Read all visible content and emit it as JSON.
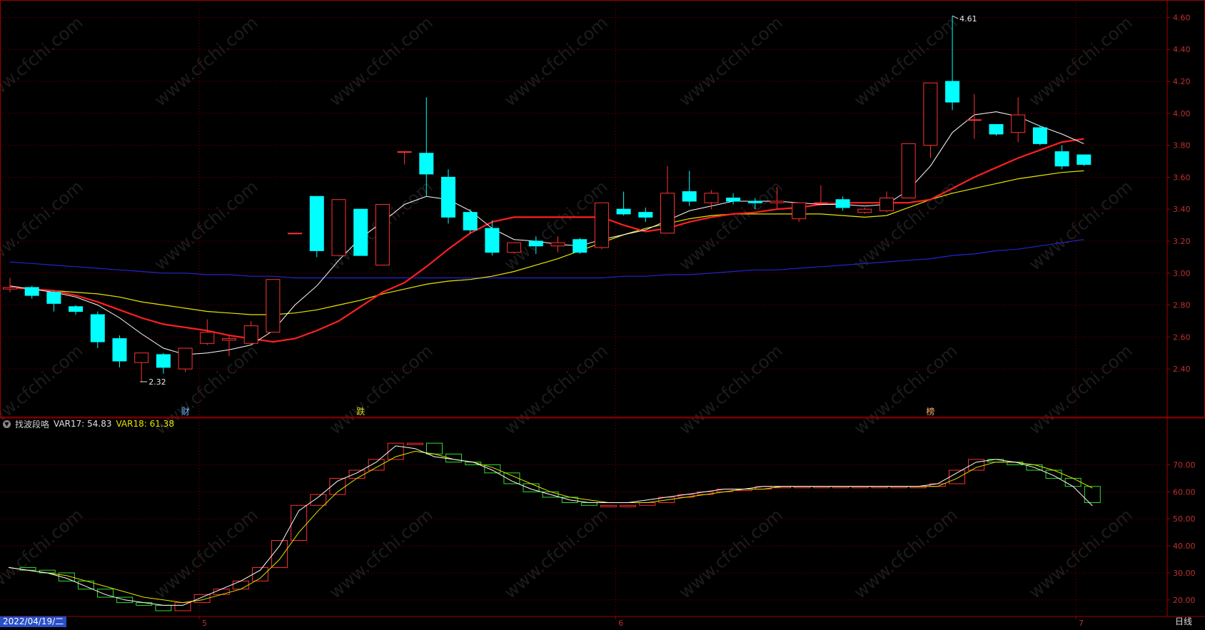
{
  "theme": {
    "background": "#000000",
    "border": "#a00000",
    "grid": "#7a0000",
    "axis_text": "#c03030",
    "up": "#ff3232",
    "down": "#00ffff",
    "ma5": "#ffffff",
    "ma10": "#ff2020",
    "ma20": "#e6e600",
    "ma60": "#2424d0",
    "osc_up": "#ff3030",
    "osc_down": "#33dd33",
    "osc_line_a": "#ffffff",
    "osc_line_b": "#e6e600"
  },
  "watermark": "www.cfchi.com",
  "price_panel": {
    "y_ticks": [
      "2.40",
      "2.60",
      "2.80",
      "3.00",
      "3.20",
      "3.40",
      "3.60",
      "3.80",
      "4.00",
      "4.20",
      "4.40",
      "4.60"
    ],
    "high_label": "4.61",
    "low_label": "2.32",
    "markers": [
      {
        "label": "财",
        "color": "#6fb4ff",
        "index": 8
      },
      {
        "label": "跌",
        "color": "#dddd22",
        "index": 16
      },
      {
        "label": "榜",
        "color": "#ffb070",
        "index": 42
      }
    ]
  },
  "indicator_panel": {
    "name": "找波段咯",
    "var17_label": "VAR17: 54.83",
    "var18_label": "VAR18: 61.38",
    "y_ticks": [
      "20.00",
      "30.00",
      "40.00",
      "50.00",
      "60.00",
      "70.00"
    ]
  },
  "x_axis": {
    "date_label": "2022/04/19/二",
    "month_labels": [
      {
        "label": "5",
        "index": 9
      },
      {
        "label": "6",
        "index": 28
      },
      {
        "label": "7",
        "index": 49
      }
    ],
    "period": "日线"
  },
  "chart_data": [
    {
      "type": "candlestick",
      "ylim": [
        2.28,
        4.66
      ],
      "y_ticks": [
        2.4,
        2.6,
        2.8,
        3.0,
        3.2,
        3.4,
        3.6,
        3.8,
        4.0,
        4.2,
        4.4,
        4.6
      ],
      "candles": [
        {
          "o": 2.9,
          "h": 2.97,
          "l": 2.88,
          "c": 2.91
        },
        {
          "o": 2.91,
          "h": 2.92,
          "l": 2.84,
          "c": 2.86
        },
        {
          "o": 2.88,
          "h": 2.89,
          "l": 2.76,
          "c": 2.81
        },
        {
          "o": 2.79,
          "h": 2.8,
          "l": 2.74,
          "c": 2.76
        },
        {
          "o": 2.74,
          "h": 2.76,
          "l": 2.53,
          "c": 2.57
        },
        {
          "o": 2.59,
          "h": 2.61,
          "l": 2.41,
          "c": 2.45
        },
        {
          "o": 2.44,
          "h": 2.5,
          "l": 2.32,
          "c": 2.5
        },
        {
          "o": 2.49,
          "h": 2.5,
          "l": 2.37,
          "c": 2.41
        },
        {
          "o": 2.4,
          "h": 2.53,
          "l": 2.38,
          "c": 2.53
        },
        {
          "o": 2.56,
          "h": 2.71,
          "l": 2.55,
          "c": 2.63
        },
        {
          "o": 2.58,
          "h": 2.61,
          "l": 2.48,
          "c": 2.59
        },
        {
          "o": 2.56,
          "h": 2.7,
          "l": 2.55,
          "c": 2.67
        },
        {
          "o": 2.63,
          "h": 2.96,
          "l": 2.63,
          "c": 2.96
        },
        {
          "o": 3.25,
          "h": 3.25,
          "l": 3.25,
          "c": 3.25
        },
        {
          "o": 3.48,
          "h": 3.48,
          "l": 3.1,
          "c": 3.14
        },
        {
          "o": 3.11,
          "h": 3.46,
          "l": 3.11,
          "c": 3.46
        },
        {
          "o": 3.4,
          "h": 3.4,
          "l": 3.11,
          "c": 3.11
        },
        {
          "o": 3.05,
          "h": 3.43,
          "l": 3.05,
          "c": 3.43
        },
        {
          "o": 3.76,
          "h": 3.76,
          "l": 3.68,
          "c": 3.76
        },
        {
          "o": 3.75,
          "h": 4.1,
          "l": 3.48,
          "c": 3.62
        },
        {
          "o": 3.6,
          "h": 3.65,
          "l": 3.31,
          "c": 3.35
        },
        {
          "o": 3.38,
          "h": 3.4,
          "l": 3.25,
          "c": 3.27
        },
        {
          "o": 3.28,
          "h": 3.33,
          "l": 3.11,
          "c": 3.13
        },
        {
          "o": 3.13,
          "h": 3.19,
          "l": 3.12,
          "c": 3.19
        },
        {
          "o": 3.2,
          "h": 3.23,
          "l": 3.12,
          "c": 3.17
        },
        {
          "o": 3.17,
          "h": 3.23,
          "l": 3.13,
          "c": 3.19
        },
        {
          "o": 3.21,
          "h": 3.22,
          "l": 3.12,
          "c": 3.13
        },
        {
          "o": 3.16,
          "h": 3.44,
          "l": 3.15,
          "c": 3.44
        },
        {
          "o": 3.4,
          "h": 3.51,
          "l": 3.36,
          "c": 3.37
        },
        {
          "o": 3.38,
          "h": 3.41,
          "l": 3.32,
          "c": 3.35
        },
        {
          "o": 3.25,
          "h": 3.67,
          "l": 3.25,
          "c": 3.5
        },
        {
          "o": 3.51,
          "h": 3.64,
          "l": 3.42,
          "c": 3.45
        },
        {
          "o": 3.44,
          "h": 3.52,
          "l": 3.4,
          "c": 3.5
        },
        {
          "o": 3.47,
          "h": 3.5,
          "l": 3.43,
          "c": 3.45
        },
        {
          "o": 3.45,
          "h": 3.47,
          "l": 3.4,
          "c": 3.44
        },
        {
          "o": 3.44,
          "h": 3.54,
          "l": 3.4,
          "c": 3.45
        },
        {
          "o": 3.34,
          "h": 3.44,
          "l": 3.32,
          "c": 3.44
        },
        {
          "o": 3.44,
          "h": 3.55,
          "l": 3.43,
          "c": 3.44
        },
        {
          "o": 3.46,
          "h": 3.48,
          "l": 3.39,
          "c": 3.41
        },
        {
          "o": 3.38,
          "h": 3.41,
          "l": 3.37,
          "c": 3.4
        },
        {
          "o": 3.39,
          "h": 3.51,
          "l": 3.38,
          "c": 3.47
        },
        {
          "o": 3.47,
          "h": 3.81,
          "l": 3.47,
          "c": 3.81
        },
        {
          "o": 3.8,
          "h": 4.19,
          "l": 3.72,
          "c": 4.19
        },
        {
          "o": 4.2,
          "h": 4.61,
          "l": 4.02,
          "c": 4.07
        },
        {
          "o": 3.96,
          "h": 4.12,
          "l": 3.84,
          "c": 3.96
        },
        {
          "o": 3.93,
          "h": 3.93,
          "l": 3.86,
          "c": 3.87
        },
        {
          "o": 3.88,
          "h": 4.1,
          "l": 3.82,
          "c": 3.99
        },
        {
          "o": 3.91,
          "h": 3.92,
          "l": 3.8,
          "c": 3.81
        },
        {
          "o": 3.76,
          "h": 3.8,
          "l": 3.65,
          "c": 3.67
        },
        {
          "o": 3.74,
          "h": 3.74,
          "l": 3.67,
          "c": 3.68
        }
      ],
      "ma5": [
        2.92,
        2.9,
        2.88,
        2.85,
        2.8,
        2.72,
        2.62,
        2.53,
        2.49,
        2.5,
        2.52,
        2.55,
        2.64,
        2.8,
        2.92,
        3.08,
        3.22,
        3.32,
        3.43,
        3.48,
        3.46,
        3.39,
        3.28,
        3.21,
        3.2,
        3.18,
        3.17,
        3.21,
        3.24,
        3.27,
        3.33,
        3.39,
        3.42,
        3.45,
        3.45,
        3.45,
        3.44,
        3.43,
        3.43,
        3.42,
        3.43,
        3.52,
        3.67,
        3.88,
        3.99,
        4.01,
        3.98,
        3.92,
        3.87,
        3.81
      ],
      "ma10": [
        2.91,
        2.9,
        2.89,
        2.86,
        2.82,
        2.77,
        2.72,
        2.68,
        2.66,
        2.64,
        2.61,
        2.59,
        2.57,
        2.59,
        2.64,
        2.7,
        2.79,
        2.88,
        2.94,
        3.04,
        3.15,
        3.25,
        3.32,
        3.35,
        3.35,
        3.35,
        3.35,
        3.35,
        3.3,
        3.26,
        3.28,
        3.32,
        3.35,
        3.37,
        3.38,
        3.4,
        3.41,
        3.43,
        3.44,
        3.44,
        3.44,
        3.44,
        3.46,
        3.53,
        3.6,
        3.66,
        3.72,
        3.77,
        3.82,
        3.84
      ],
      "ma20": [
        2.91,
        2.9,
        2.89,
        2.88,
        2.87,
        2.85,
        2.82,
        2.8,
        2.78,
        2.76,
        2.75,
        2.74,
        2.74,
        2.75,
        2.77,
        2.8,
        2.83,
        2.87,
        2.9,
        2.93,
        2.95,
        2.96,
        2.98,
        3.01,
        3.05,
        3.09,
        3.14,
        3.19,
        3.24,
        3.28,
        3.31,
        3.34,
        3.36,
        3.37,
        3.37,
        3.37,
        3.37,
        3.37,
        3.36,
        3.35,
        3.36,
        3.41,
        3.46,
        3.5,
        3.53,
        3.56,
        3.59,
        3.61,
        3.63,
        3.64
      ],
      "ma60": [
        3.07,
        3.06,
        3.05,
        3.04,
        3.03,
        3.02,
        3.01,
        3.0,
        3.0,
        2.99,
        2.99,
        2.98,
        2.98,
        2.97,
        2.97,
        2.97,
        2.97,
        2.97,
        2.97,
        2.97,
        2.97,
        2.97,
        2.97,
        2.97,
        2.97,
        2.97,
        2.97,
        2.97,
        2.98,
        2.98,
        2.99,
        2.99,
        3.0,
        3.01,
        3.02,
        3.02,
        3.03,
        3.04,
        3.05,
        3.06,
        3.07,
        3.08,
        3.09,
        3.11,
        3.12,
        3.14,
        3.15,
        3.17,
        3.19,
        3.21
      ]
    },
    {
      "type": "oscillator",
      "name": "找波段咯",
      "ylim": [
        16,
        82
      ],
      "y_ticks": [
        20,
        30,
        40,
        50,
        60,
        70
      ],
      "values": [
        32,
        31,
        30,
        27,
        24,
        21,
        19,
        18,
        16,
        19,
        22,
        24,
        27,
        32,
        42,
        55,
        59,
        65,
        68,
        72,
        78,
        78,
        74,
        71,
        70,
        67,
        63,
        60,
        58,
        56,
        55,
        55,
        55,
        56,
        58,
        59,
        60,
        61,
        61,
        62,
        62,
        62,
        62,
        62,
        62,
        62,
        62,
        62,
        63,
        68,
        72,
        71,
        70,
        68,
        65,
        62,
        56
      ],
      "var17": [
        32,
        31,
        30,
        28,
        25,
        22,
        20,
        19,
        18,
        18,
        21,
        24,
        27,
        31,
        40,
        53,
        58,
        64,
        67,
        71,
        77,
        76,
        73,
        72,
        71,
        68,
        64,
        61,
        59,
        57,
        56,
        56,
        56,
        57,
        58,
        59,
        60,
        61,
        61,
        62,
        62,
        62,
        62,
        62,
        62,
        62,
        62,
        62,
        63,
        67,
        71,
        72,
        71,
        69,
        66,
        62,
        54.83
      ],
      "var18": [
        32,
        31,
        30,
        29,
        27,
        25,
        23,
        21,
        20,
        19,
        20,
        22,
        24,
        28,
        35,
        45,
        53,
        60,
        65,
        69,
        73,
        75,
        74,
        72,
        71,
        69,
        66,
        63,
        60,
        58,
        57,
        56,
        56,
        56,
        57,
        58,
        59,
        60,
        61,
        61,
        62,
        62,
        62,
        62,
        62,
        62,
        62,
        62,
        62,
        65,
        69,
        71,
        71,
        70,
        68,
        65,
        61.38
      ]
    }
  ]
}
